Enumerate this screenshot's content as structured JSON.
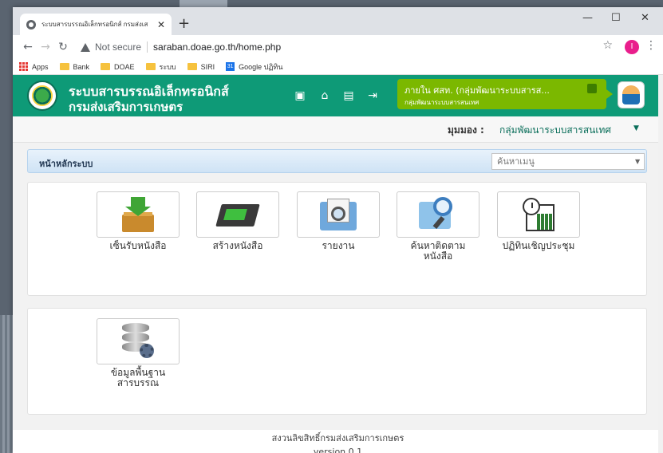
{
  "browser": {
    "tab_title": "ระบบสารบรรณอิเล็กทรอนิกส์ กรมส่งเส",
    "url_warning": "Not secure",
    "url": "saraban.doae.go.th/home.php",
    "profile_initial": "I",
    "bookmarks": [
      "Apps",
      "Bank",
      "DOAE",
      "ระบบ",
      "SIRI",
      "Google ปฏิทิน"
    ]
  },
  "header": {
    "title_line1": "ระบบสารบรรณอิเล็กทรอนิกส์",
    "title_line2": "กรมส่งเสริมการเกษตร",
    "user_name": "ภายใน ศสท. (กลุ่มพัฒนาระบบสารส...",
    "user_group": "กลุ่มพัฒนาระบบสารสนเทศ"
  },
  "viewbar": {
    "label": "มุมมอง :",
    "value": "กลุ่มพัฒนาระบบสารสนเทศ"
  },
  "breadcrumb": "หน้าหลักระบบ",
  "search": {
    "placeholder": "ค้นหาเมนู"
  },
  "tiles_main": [
    {
      "label": "เซ็นรับหนังสือ",
      "icon": "inbox-download-icon"
    },
    {
      "label": "สร้างหนังสือ",
      "icon": "envelope-send-icon"
    },
    {
      "label": "รายงาน",
      "icon": "report-search-icon"
    },
    {
      "label": "ค้นหาติดตาม\nหนังสือ",
      "icon": "folder-search-icon"
    },
    {
      "label": "ปฏิทินเชิญประชุม",
      "icon": "calendar-clock-icon"
    }
  ],
  "tiles_admin": [
    {
      "label": "ข้อมูลพื้นฐาน\nสารบรรณ",
      "icon": "database-gear-icon"
    }
  ],
  "footer": {
    "line1": "สงวนลิขสิทธิ์กรมส่งเสริมการเกษตร",
    "line2": "version 0.1"
  },
  "colors": {
    "header_green": "#0e9a77",
    "user_box": "#7bb800",
    "breadcrumb_bg": "#cfe3f5"
  }
}
